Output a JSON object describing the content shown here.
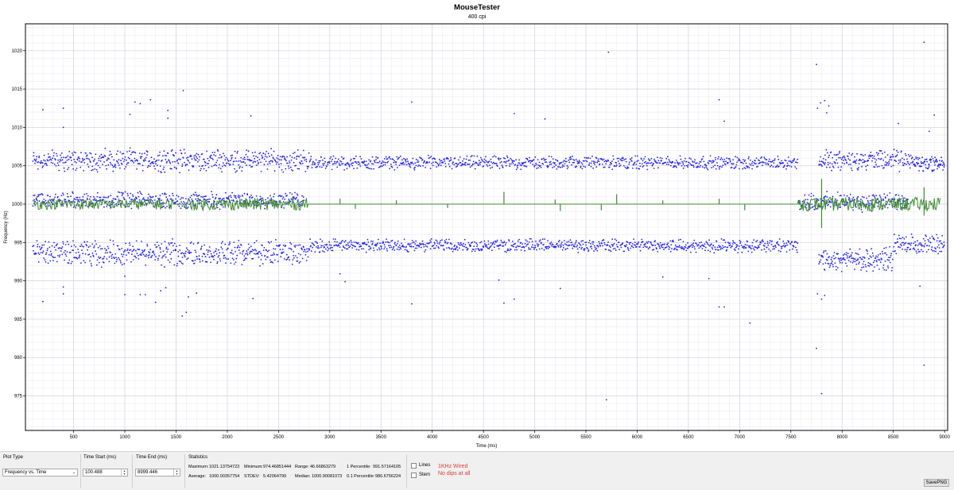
{
  "chart_data": {
    "type": "scatter",
    "title": "MouseTester",
    "subtitle": "400 cpi",
    "xlabel": "Time (ms)",
    "ylabel": "Frequency (Hz)",
    "xlim": [
      30,
      9030
    ],
    "ylim": [
      970.5,
      1023.5
    ],
    "x_ticks": [
      500,
      1000,
      1500,
      2000,
      2500,
      3000,
      3500,
      4000,
      4500,
      5000,
      5500,
      6000,
      6500,
      7000,
      7500,
      8000,
      8500,
      9000
    ],
    "x_minor_step": 100,
    "y_ticks": [
      975,
      980,
      985,
      990,
      995,
      1000,
      1005,
      1010,
      1015,
      1020
    ],
    "y_minor_step": 1,
    "grid": true,
    "point_color": "#2222ee",
    "line_color": "#3f8a2e",
    "series": [
      {
        "type": "scatter",
        "bands": [
          {
            "x_start": 100,
            "x_end": 2800,
            "center": 1005.7,
            "spread": 1.7,
            "count": 560
          },
          {
            "x_start": 2800,
            "x_end": 7570,
            "center": 1005.4,
            "spread": 1.0,
            "count": 900
          },
          {
            "x_start": 7770,
            "x_end": 8700,
            "center": 1005.7,
            "spread": 1.6,
            "count": 200
          },
          {
            "x_start": 8700,
            "x_end": 9000,
            "center": 1005.3,
            "spread": 1.3,
            "count": 80
          },
          {
            "x_start": 100,
            "x_end": 2750,
            "center": 1000.5,
            "spread": 1.2,
            "count": 520
          },
          {
            "x_start": 7570,
            "x_end": 8650,
            "center": 1000.3,
            "spread": 1.4,
            "count": 210
          },
          {
            "x_start": 100,
            "x_end": 2800,
            "center": 993.6,
            "spread": 1.9,
            "count": 560
          },
          {
            "x_start": 2800,
            "x_end": 7570,
            "center": 994.6,
            "spread": 1.0,
            "count": 900
          },
          {
            "x_start": 7770,
            "x_end": 8500,
            "center": 992.8,
            "spread": 1.7,
            "count": 170
          },
          {
            "x_start": 8500,
            "x_end": 9000,
            "center": 994.7,
            "spread": 1.6,
            "count": 110
          }
        ],
        "outliers": [
          [
            200,
            1012.3
          ],
          [
            400,
            1012.5
          ],
          [
            400,
            1010
          ],
          [
            200,
            987.3
          ],
          [
            400,
            989.2
          ],
          [
            400,
            988.3
          ],
          [
            1000,
            988.2
          ],
          [
            1000,
            990.6
          ],
          [
            1050,
            1011.7
          ],
          [
            1100,
            1013.3
          ],
          [
            1150,
            988.2
          ],
          [
            1150,
            1013.1
          ],
          [
            1200,
            988.2
          ],
          [
            1250,
            1013.6
          ],
          [
            1300,
            987.2
          ],
          [
            1350,
            988.7
          ],
          [
            1420,
            1012.2
          ],
          [
            1420,
            1011.2
          ],
          [
            1400,
            989.1
          ],
          [
            1570,
            1014.8
          ],
          [
            1560,
            985.4
          ],
          [
            1600,
            985.9
          ],
          [
            1620,
            987.9
          ],
          [
            1700,
            988.4
          ],
          [
            2230,
            1011.5
          ],
          [
            2250,
            987.7
          ],
          [
            2700,
            1006.2
          ],
          [
            3100,
            990.9
          ],
          [
            3150,
            989.9
          ],
          [
            3800,
            1013.3
          ],
          [
            3800,
            987
          ],
          [
            4650,
            990.1
          ],
          [
            4700,
            987.1
          ],
          [
            4800,
            1011.8
          ],
          [
            4800,
            987.6
          ],
          [
            5100,
            1011.1
          ],
          [
            5250,
            989
          ],
          [
            5700,
            974.5
          ],
          [
            5720,
            1019.8
          ],
          [
            6250,
            990.5
          ],
          [
            6700,
            990.3
          ],
          [
            6800,
            1013.6
          ],
          [
            6800,
            986.6
          ],
          [
            6850,
            1010.8
          ],
          [
            6850,
            986.6
          ],
          [
            7100,
            984.5
          ],
          [
            7750,
            1018.2
          ],
          [
            7750,
            981.2
          ],
          [
            7800,
            975.3
          ],
          [
            7760,
            1012.5
          ],
          [
            7790,
            1013.2
          ],
          [
            7830,
            1013.5
          ],
          [
            7870,
            1012.8
          ],
          [
            7760,
            988.3
          ],
          [
            7800,
            987.6
          ],
          [
            7830,
            988.1
          ],
          [
            7850,
            1011.9
          ],
          [
            8550,
            1010.5
          ],
          [
            8800,
            1021.1
          ],
          [
            8800,
            979
          ],
          [
            8900,
            1011.6
          ],
          [
            8850,
            1009.5
          ],
          [
            8760,
            989.3
          ]
        ]
      },
      {
        "type": "line",
        "baseline": 1000,
        "noisy_segments": [
          {
            "x_start": 100,
            "x_end": 1470,
            "amplitude": 0.7
          },
          {
            "x_start": 1570,
            "x_end": 2780,
            "amplitude": 0.8
          },
          {
            "x_start": 7570,
            "x_end": 8960,
            "amplitude": 0.9
          }
        ],
        "spikes": [
          [
            3100,
            0.7
          ],
          [
            3250,
            -0.6
          ],
          [
            3650,
            0.5
          ],
          [
            4150,
            -0.5
          ],
          [
            4700,
            1.6
          ],
          [
            5200,
            0.6
          ],
          [
            5250,
            -0.9
          ],
          [
            5650,
            -0.8
          ],
          [
            5800,
            1.3
          ],
          [
            6250,
            0.5
          ],
          [
            6800,
            0.7
          ],
          [
            7050,
            -0.8
          ],
          [
            7800,
            3.3
          ],
          [
            7800,
            -3.1
          ],
          [
            8800,
            2.2
          ],
          [
            8800,
            -1.5
          ]
        ]
      }
    ]
  },
  "controls": {
    "plot_type": {
      "label": "Plot Type",
      "value": "Frequency vs. Time"
    },
    "time_start": {
      "label": "Time Start (ms)",
      "value": "100.488"
    },
    "time_end": {
      "label": "Time End (ms)",
      "value": "8999.446"
    },
    "statistics": {
      "label": "Statistics",
      "maximum_label": "Maximum:",
      "maximum": "1021.13754723",
      "minimum_label": "Minimum:",
      "minimum": "974.46851444",
      "range_label": "Range:",
      "range": "46.66863279",
      "p1_label": "1 Percentile:",
      "p1": "991.57164105",
      "average_label": "Average:",
      "average": "1000.00357754",
      "stdev_label": "STDEV:",
      "stdev": "5.42064799",
      "median_label": "Median:",
      "median": "1000.90081073",
      "p01_label": "0.1 Percentile:",
      "p01": "986.6756224"
    },
    "lines_label": "Lines",
    "stem_label": "Stem",
    "note_line1": "1KHz Wired",
    "note_line2": "No dips at all",
    "save_label": "SavePNG"
  }
}
